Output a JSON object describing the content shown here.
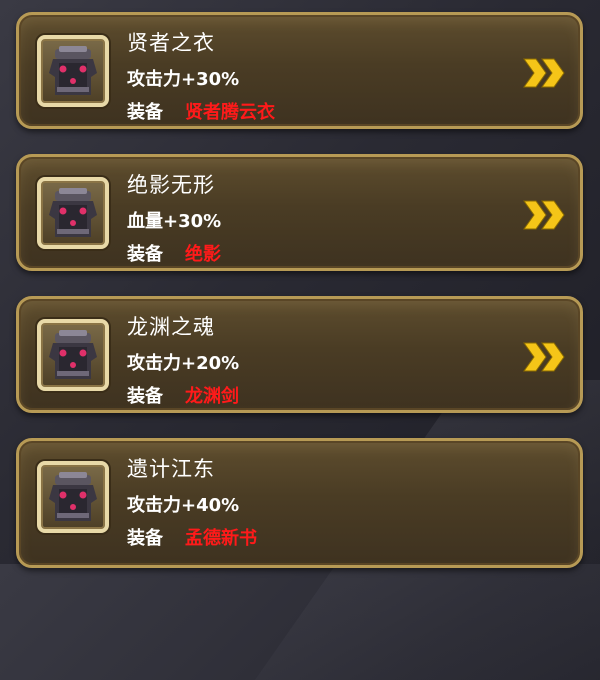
{
  "cards": [
    {
      "title": "贤者之衣",
      "stat": "攻击力+30%",
      "equip_label": "装备",
      "equip_name": "贤者腾云衣",
      "has_arrow": true,
      "icon": "armor-icon"
    },
    {
      "title": "绝影无形",
      "stat": "血量+30%",
      "equip_label": "装备",
      "equip_name": "绝影",
      "has_arrow": true,
      "icon": "armor-icon"
    },
    {
      "title": "龙渊之魂",
      "stat": "攻击力+20%",
      "equip_label": "装备",
      "equip_name": "龙渊剑",
      "has_arrow": true,
      "icon": "armor-icon"
    },
    {
      "title": "遗计江东",
      "stat": "攻击力+40%",
      "equip_label": "装备",
      "equip_name": "孟德新书",
      "has_arrow": false,
      "icon": "armor-icon"
    }
  ],
  "colors": {
    "card_border": "#b79a55",
    "card_fill": "#4a3c24",
    "equip_name": "#ff1a1a",
    "arrow": "#f5c518"
  }
}
